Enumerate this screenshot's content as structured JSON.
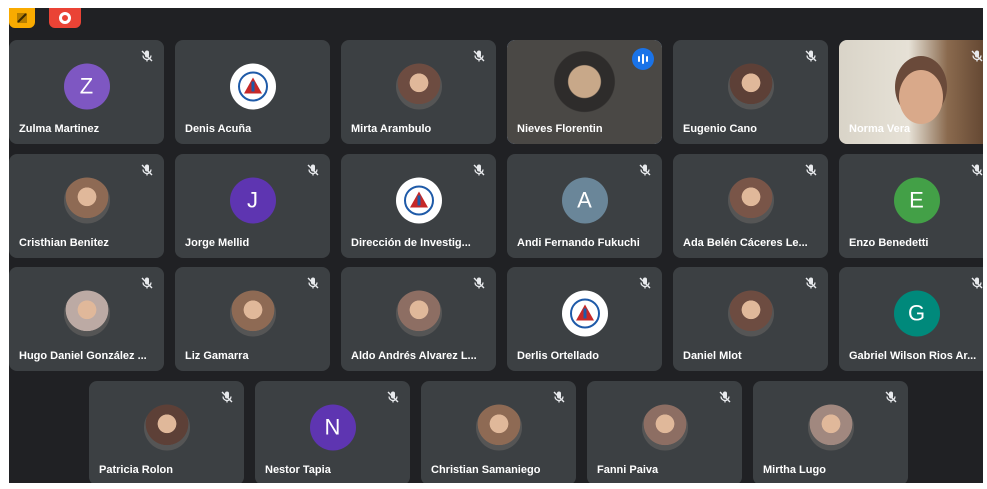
{
  "toolbar": {
    "icons": [
      "pen-icon",
      "record-icon"
    ],
    "colors": {
      "pen": "#f9ab00",
      "record": "#ea4335"
    }
  },
  "participants": [
    {
      "name": "Zulma Martinez",
      "initial": "Z",
      "color": "#7e57c2",
      "muted": true
    },
    {
      "name": "Denis Acuña",
      "photo": "logo-avatar",
      "muted": false
    },
    {
      "name": "Mirta Arambulo",
      "photo": "photo-avatar",
      "muted": true
    },
    {
      "name": "Nieves Florentin",
      "video": true,
      "speaking": true,
      "muted": false
    },
    {
      "name": "Eugenio Cano",
      "photo": "photo-avatar",
      "muted": true
    },
    {
      "name": "Norma Vera",
      "video": true,
      "muted": true
    },
    {
      "name": "Cristhian Benitez",
      "photo": "photo-avatar",
      "muted": true
    },
    {
      "name": "Jorge Mellid",
      "initial": "J",
      "color": "#5e35b1",
      "muted": true
    },
    {
      "name": "Dirección de Investig...",
      "photo": "logo-avatar",
      "muted": true
    },
    {
      "name": "Andi Fernando Fukuchi",
      "initial": "A",
      "color": "#6a8699",
      "muted": true
    },
    {
      "name": "Ada Belén Cáceres Le...",
      "photo": "photo-avatar",
      "muted": true
    },
    {
      "name": "Enzo Benedetti",
      "initial": "E",
      "color": "#43a047",
      "muted": true
    },
    {
      "name": "Hugo Daniel González ...",
      "photo": "photo-avatar",
      "muted": true
    },
    {
      "name": "Liz Gamarra",
      "photo": "photo-avatar",
      "muted": true
    },
    {
      "name": "Aldo Andrés Alvarez L...",
      "photo": "photo-avatar",
      "muted": true
    },
    {
      "name": "Derlis Ortellado",
      "photo": "logo-avatar",
      "muted": true
    },
    {
      "name": "Daniel Mlot",
      "photo": "photo-avatar",
      "muted": true
    },
    {
      "name": "Gabriel Wilson Rios Ar...",
      "initial": "G",
      "color": "#00897b",
      "muted": true
    },
    {
      "name": "Patricia Rolon",
      "photo": "photo-avatar",
      "muted": true
    },
    {
      "name": "Nestor Tapia",
      "initial": "N",
      "color": "#5e35b1",
      "muted": true
    },
    {
      "name": "Christian Samaniego",
      "photo": "photo-avatar",
      "muted": true
    },
    {
      "name": "Fanni Paiva",
      "photo": "photo-avatar",
      "muted": true
    },
    {
      "name": "Mirtha Lugo",
      "photo": "photo-avatar",
      "muted": true
    }
  ]
}
